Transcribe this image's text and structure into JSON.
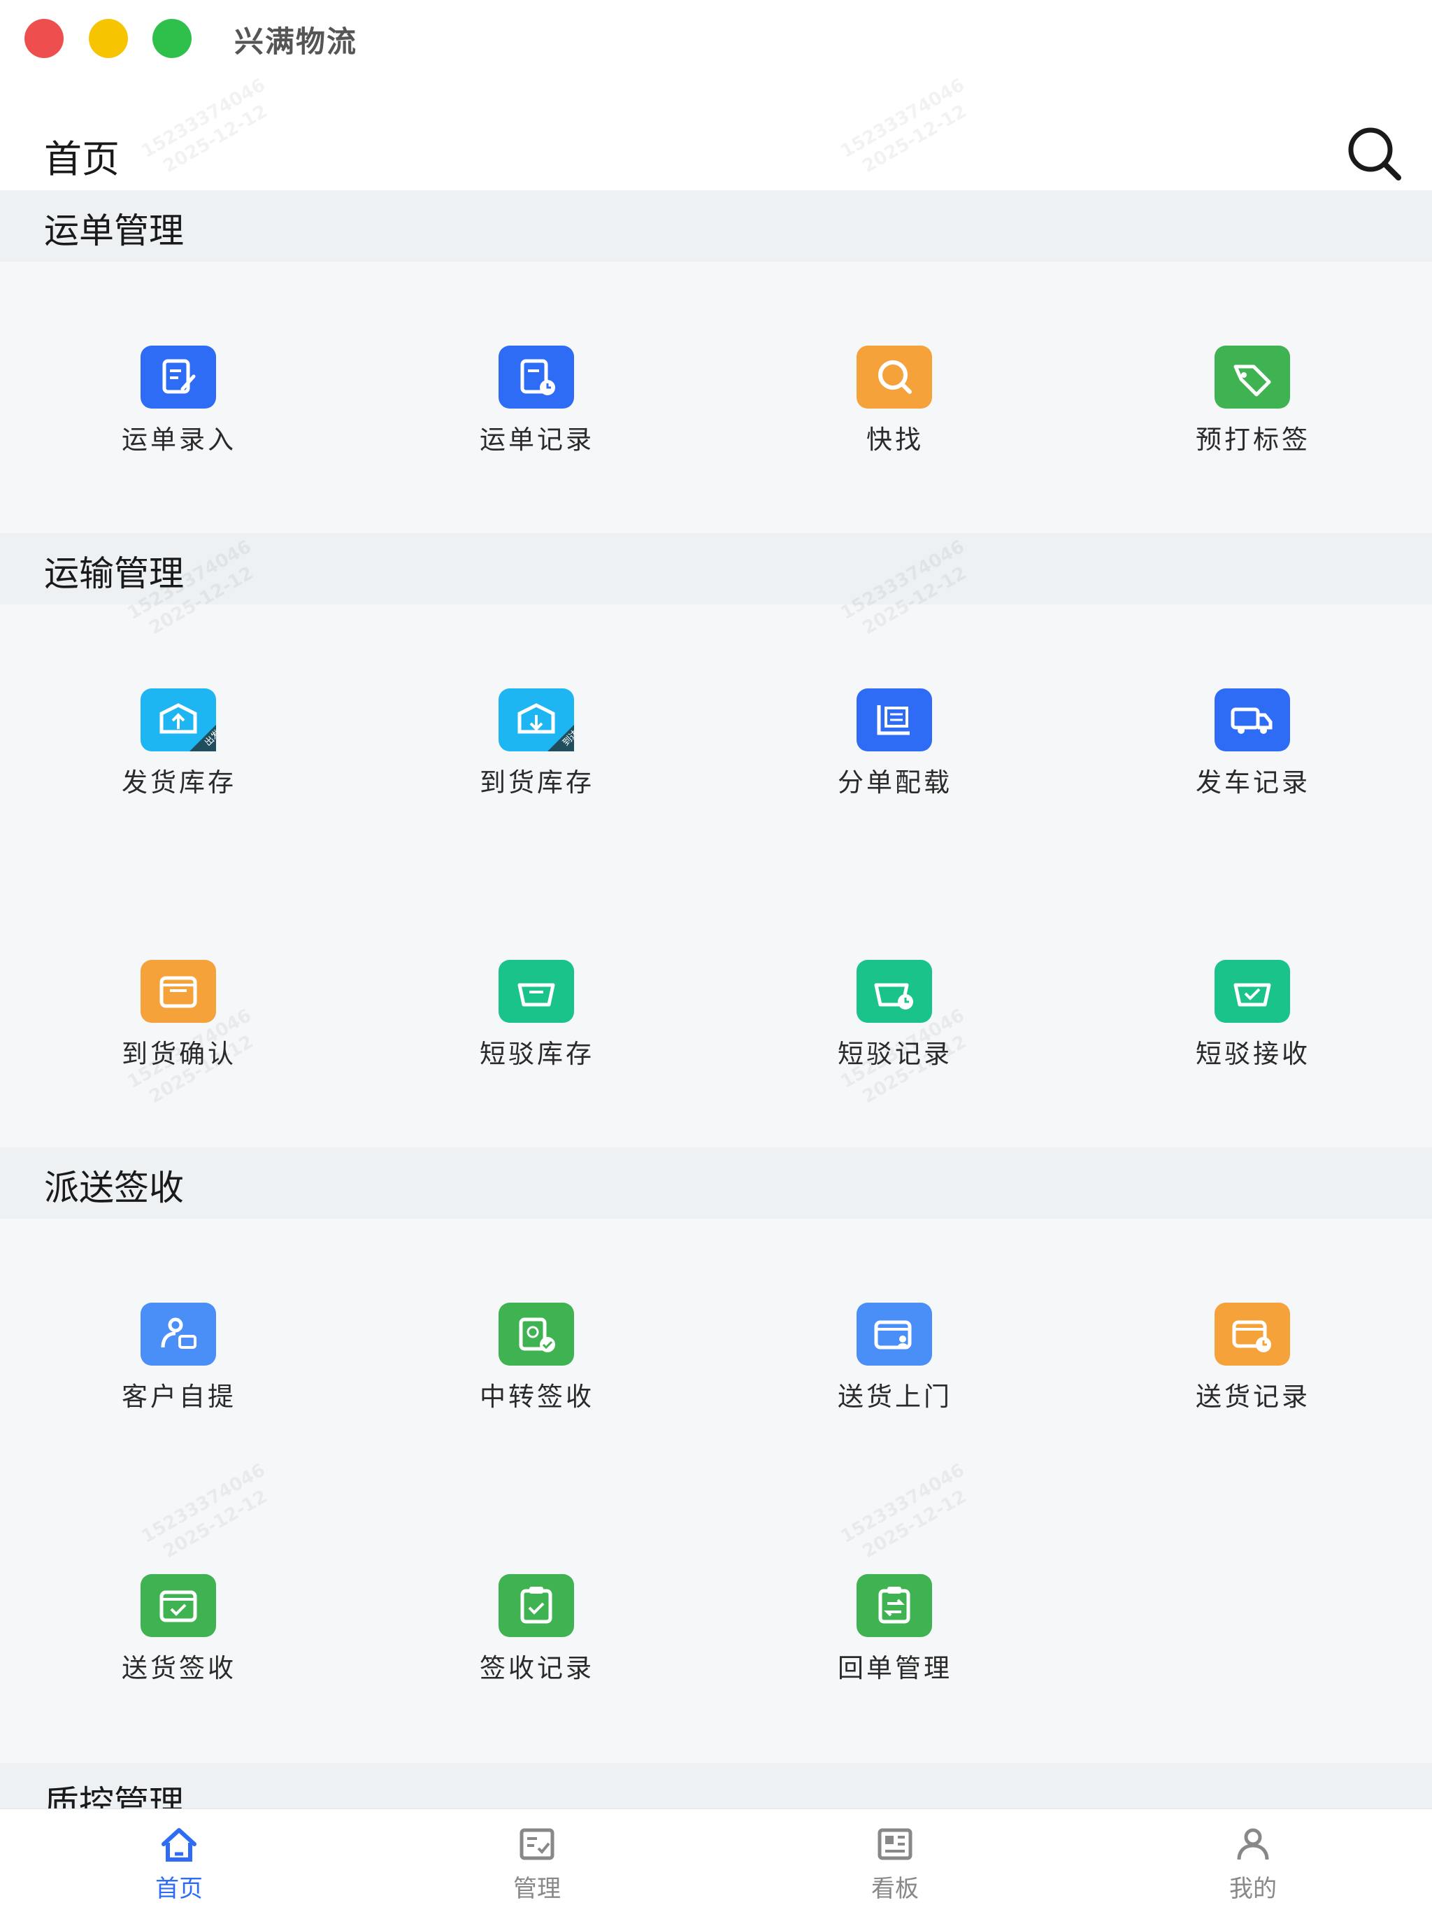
{
  "window": {
    "title": "兴满物流"
  },
  "header": {
    "title": "首页"
  },
  "watermark": {
    "line1": "15233374046",
    "line2": "2025-12-12"
  },
  "sections": [
    {
      "title": "运单管理",
      "items": [
        {
          "label": "运单录入",
          "icon": "edit-doc-icon",
          "color": "#2f6cf6"
        },
        {
          "label": "运单记录",
          "icon": "doc-clock-icon",
          "color": "#2f6cf6"
        },
        {
          "label": "快找",
          "icon": "search-icon",
          "color": "#f6a23a"
        },
        {
          "label": "预打标签",
          "icon": "tag-icon",
          "color": "#3fb352"
        }
      ]
    },
    {
      "title": "运输管理",
      "items": [
        {
          "label": "发货库存",
          "icon": "box-out-icon",
          "color": "#1eb6f2",
          "badge": "出发"
        },
        {
          "label": "到货库存",
          "icon": "box-in-icon",
          "color": "#1eb6f2",
          "badge": "到达"
        },
        {
          "label": "分单配载",
          "icon": "split-load-icon",
          "color": "#2f6cf6"
        },
        {
          "label": "发车记录",
          "icon": "truck-icon",
          "color": "#2f6cf6"
        },
        {
          "label": "到货确认",
          "icon": "inbox-icon",
          "color": "#f6a23a"
        },
        {
          "label": "短驳库存",
          "icon": "tray-icon",
          "color": "#19c38a"
        },
        {
          "label": "短驳记录",
          "icon": "tray-clock-icon",
          "color": "#19c38a"
        },
        {
          "label": "短驳接收",
          "icon": "tray-check-icon",
          "color": "#19c38a"
        }
      ]
    },
    {
      "title": "派送签收",
      "items": [
        {
          "label": "客户自提",
          "icon": "user-box-icon",
          "color": "#4a8ef7"
        },
        {
          "label": "中转签收",
          "icon": "transfer-sign-icon",
          "color": "#3fb352"
        },
        {
          "label": "送货上门",
          "icon": "card-user-icon",
          "color": "#4a8ef7"
        },
        {
          "label": "送货记录",
          "icon": "card-clock-icon",
          "color": "#f6a23a"
        },
        {
          "label": "送货签收",
          "icon": "box-check-icon",
          "color": "#3fb352"
        },
        {
          "label": "签收记录",
          "icon": "clipboard-check-icon",
          "color": "#3fb352"
        },
        {
          "label": "回单管理",
          "icon": "receipt-swap-icon",
          "color": "#3fb352"
        }
      ]
    },
    {
      "title": "质控管理",
      "items": []
    }
  ],
  "tabs": [
    {
      "label": "首页",
      "icon": "home-icon",
      "active": true,
      "color": "#2f6cf6"
    },
    {
      "label": "管理",
      "icon": "manage-icon",
      "active": false,
      "color": "#888888"
    },
    {
      "label": "看板",
      "icon": "board-icon",
      "active": false,
      "color": "#888888"
    },
    {
      "label": "我的",
      "icon": "user-icon",
      "active": false,
      "color": "#888888"
    }
  ]
}
